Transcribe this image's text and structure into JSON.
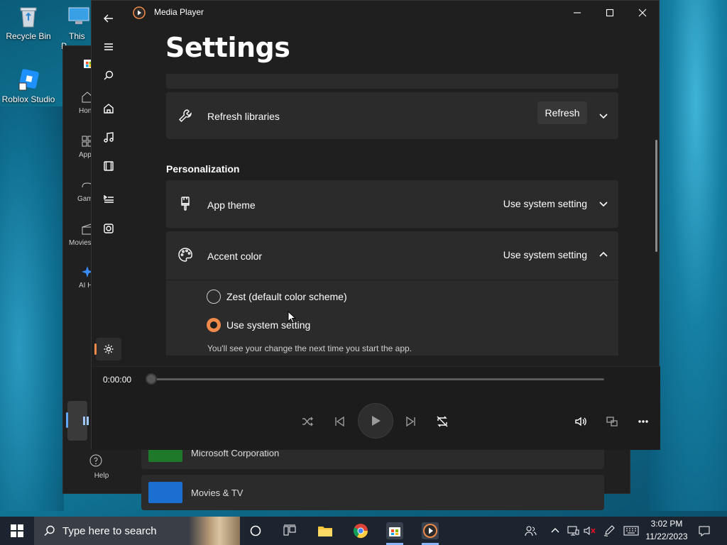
{
  "desktop": {
    "icons": [
      {
        "label": "Recycle Bin"
      },
      {
        "label": "This P"
      },
      {
        "label": "Roblox Studio"
      }
    ]
  },
  "store": {
    "nav": [
      {
        "label": "Hon"
      },
      {
        "label": "App"
      },
      {
        "label": "Gam"
      },
      {
        "label": "Movies"
      },
      {
        "label": "AI H"
      },
      {
        "label": "Help"
      }
    ],
    "rows": [
      {
        "text": "Microsoft Corporation"
      },
      {
        "text": "Movies & TV"
      }
    ]
  },
  "player_app": {
    "title": "Media Player",
    "page_title": "Settings",
    "refresh_row": {
      "label": "Refresh libraries",
      "button": "Refresh"
    },
    "section": "Personalization",
    "app_theme": {
      "label": "App theme",
      "value": "Use system setting"
    },
    "accent": {
      "label": "Accent color",
      "value": "Use system setting",
      "options": [
        {
          "label": "Zest (default color scheme)",
          "selected": false
        },
        {
          "label": "Use system setting",
          "selected": true
        }
      ],
      "hint": "You'll see your change the next time you start the app."
    },
    "accent_color": "#f08a4b",
    "playback": {
      "time": "0:00:00",
      "progress": 0
    }
  },
  "taskbar": {
    "search_placeholder": "Type here to search",
    "clock_time": "3:02 PM",
    "clock_date": "11/22/2023"
  }
}
